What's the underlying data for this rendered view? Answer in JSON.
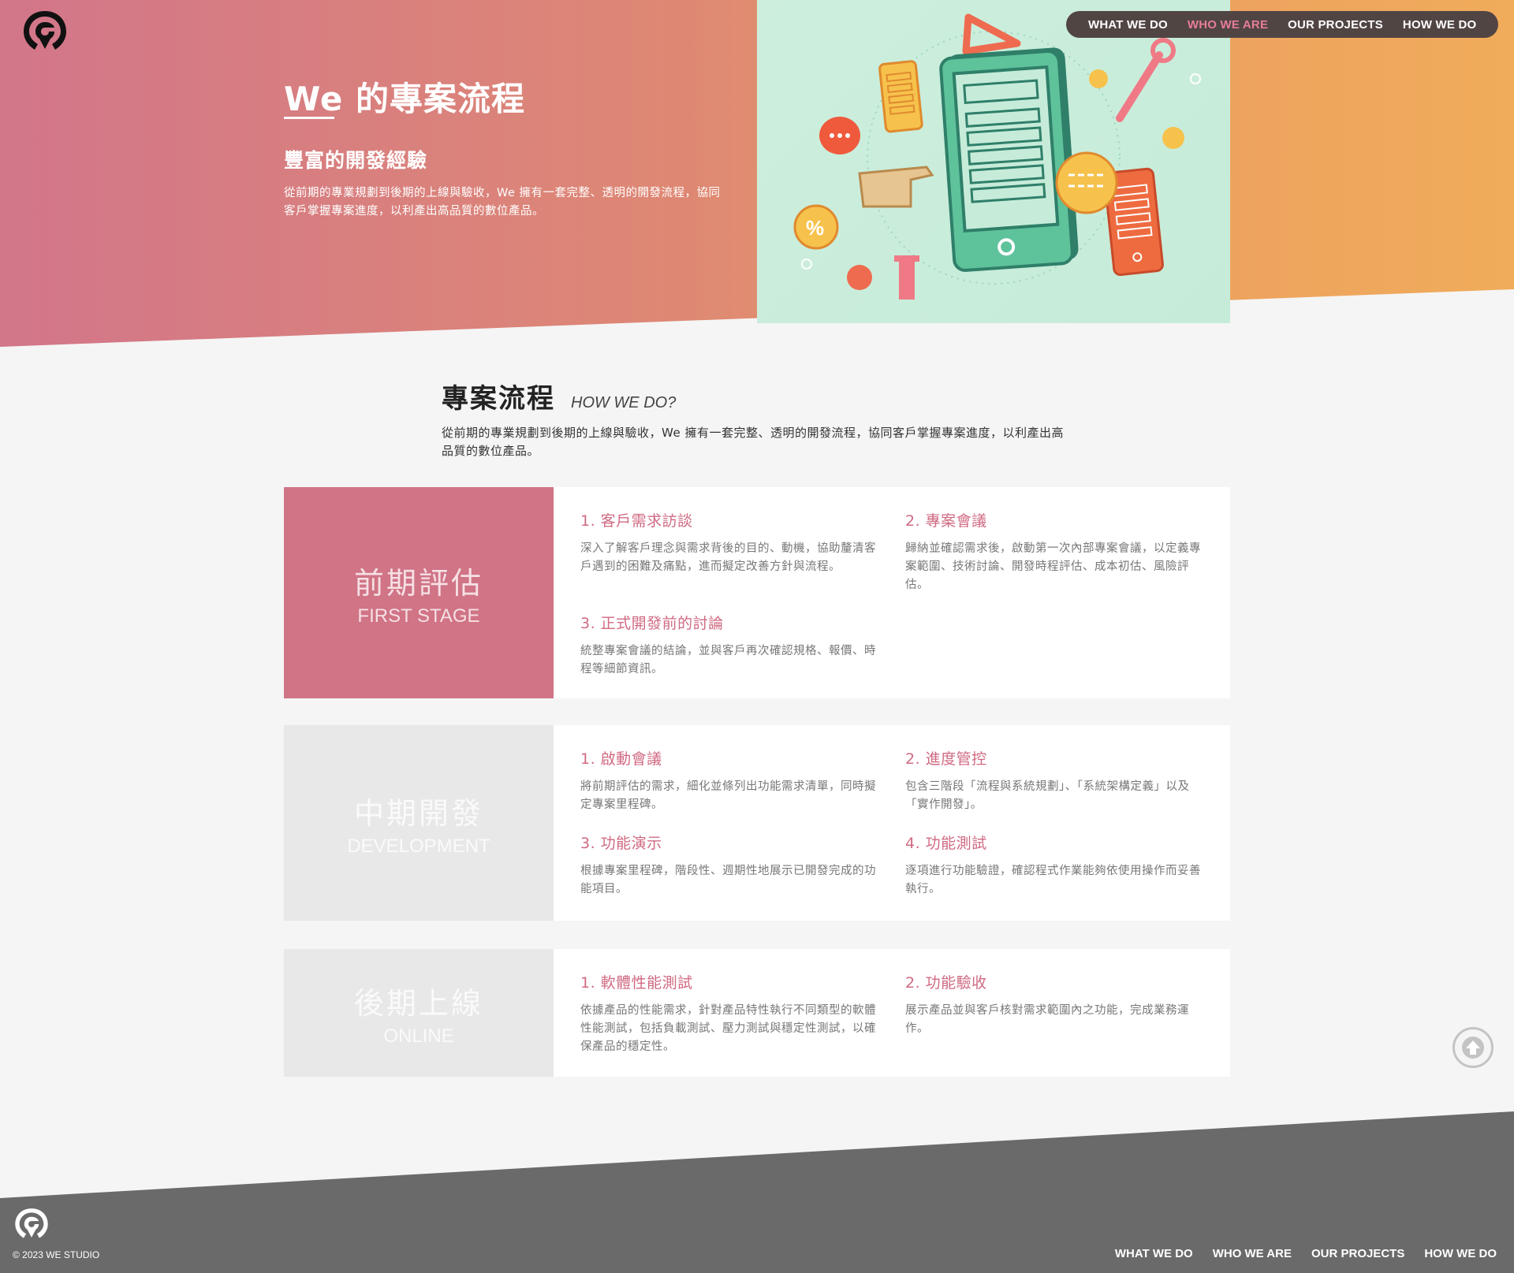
{
  "nav": {
    "items": [
      {
        "label": "WHAT WE DO",
        "active": false
      },
      {
        "label": "WHO WE ARE",
        "active": true
      },
      {
        "label": "OUR PROJECTS",
        "active": false
      },
      {
        "label": "HOW WE DO",
        "active": false
      }
    ]
  },
  "hero": {
    "title": "We 的專案流程",
    "subtitle": "豐富的開發經驗",
    "description": "從前期的專業規劃到後期的上線與驗收，We 擁有一套完整、透明的開發流程，協同客戶掌握專案進度，以利產出高品質的數位產品。"
  },
  "section": {
    "title_zh": "專案流程",
    "title_en": "HOW WE DO?",
    "description": "從前期的專業規劃到後期的上線與驗收，We 擁有一套完整、透明的開發流程，協同客戶掌握專案進度，以利產出高品質的數位產品。"
  },
  "stages": [
    {
      "title_zh": "前期評估",
      "title_en": "FIRST STAGE",
      "steps": [
        {
          "title": "1. 客戶需求訪談",
          "desc": "深入了解客戶理念與需求背後的目的、動機，協助釐清客戶遇到的困難及痛點，進而擬定改善方針與流程。"
        },
        {
          "title": "2. 專案會議",
          "desc": "歸納並確認需求後，啟動第一次內部專案會議，以定義專案範圍、技術討論、開發時程評估、成本初估、風險評估。"
        },
        {
          "title": "3. 正式開發前的討論",
          "desc": "統整專案會議的結論，並與客戶再次確認規格、報價、時程等細節資訊。"
        }
      ]
    },
    {
      "title_zh": "中期開發",
      "title_en": "DEVELOPMENT",
      "steps": [
        {
          "title": "1. 啟動會議",
          "desc": "將前期評估的需求，細化並條列出功能需求清單，同時擬定專案里程碑。"
        },
        {
          "title": "2. 進度管控",
          "desc": "包含三階段「流程與系統規劃」、「系統架構定義」以及「實作開發」。"
        },
        {
          "title": "3. 功能演示",
          "desc": "根據專案里程碑，階段性、週期性地展示已開發完成的功能項目。"
        },
        {
          "title": "4. 功能測試",
          "desc": "逐項進行功能驗證，確認程式作業能夠依使用操作而妥善執行。"
        }
      ]
    },
    {
      "title_zh": "後期上線",
      "title_en": "ONLINE",
      "steps": [
        {
          "title": "1. 軟體性能測試",
          "desc": "依據產品的性能需求，針對產品特性執行不同類型的軟體性能測試，包括負載測試、壓力測試與穩定性測試，以確保產品的穩定性。"
        },
        {
          "title": "2. 功能驗收",
          "desc": "展示產品並與客戶核對需求範圍內之功能，完成業務運作。"
        }
      ]
    }
  ],
  "footer": {
    "copyright": "© 2023 WE STUDIO",
    "nav": [
      "WHAT WE DO",
      "WHO WE ARE",
      "OUR PROJECTS",
      "HOW WE DO"
    ]
  },
  "colors": {
    "accent": "#d06a82",
    "stage_active": "#d07486",
    "nav_bg": "#514544",
    "footer_bg": "#6a6a6a"
  }
}
